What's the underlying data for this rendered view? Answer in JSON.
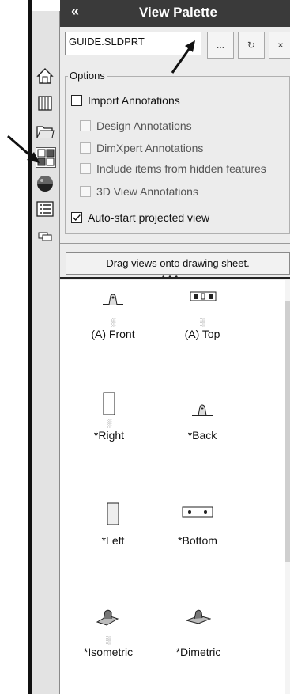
{
  "left_strip": {
    "topstub_text": "—",
    "tabs": [
      {
        "icon": "home-icon"
      },
      {
        "icon": "part-library-icon"
      },
      {
        "icon": "folder-icon"
      },
      {
        "icon": "view-palette-icon"
      },
      {
        "icon": "appearances-icon"
      },
      {
        "icon": "custom-properties-icon"
      },
      {
        "icon": "forum-icon"
      }
    ]
  },
  "header": {
    "collapse_label": "«",
    "title": "View Palette",
    "pin_label": "→"
  },
  "file_selector": {
    "value": "GUIDE.SLDPRT",
    "browse_label": "...",
    "refresh_label": "↻",
    "close_label": "×"
  },
  "options": {
    "group_label": "Options",
    "items": [
      {
        "label": "Import Annotations",
        "checked": false,
        "enabled": true
      },
      {
        "label": "Design Annotations",
        "checked": false,
        "enabled": false
      },
      {
        "label": "DimXpert Annotations",
        "checked": false,
        "enabled": false
      },
      {
        "label": "Include items from hidden features",
        "checked": false,
        "enabled": false
      },
      {
        "label": "3D View Annotations",
        "checked": false,
        "enabled": false
      },
      {
        "label": "Auto-start projected view",
        "checked": true,
        "enabled": true
      }
    ]
  },
  "drag_hint": "Drag views onto drawing sheet.",
  "views": [
    {
      "label": "(A) Front",
      "annotated": true,
      "annotation_glyph": "░"
    },
    {
      "label": "(A) Top",
      "annotated": true,
      "annotation_glyph": "░"
    },
    {
      "label": "*Right",
      "annotated": true,
      "annotation_glyph": "░"
    },
    {
      "label": "*Back",
      "annotated": false
    },
    {
      "label": "*Left",
      "annotated": false
    },
    {
      "label": "*Bottom",
      "annotated": false
    },
    {
      "label": "*Isometric",
      "annotated": true,
      "annotation_glyph": "░"
    },
    {
      "label": "*Dimetric",
      "annotated": false
    }
  ]
}
